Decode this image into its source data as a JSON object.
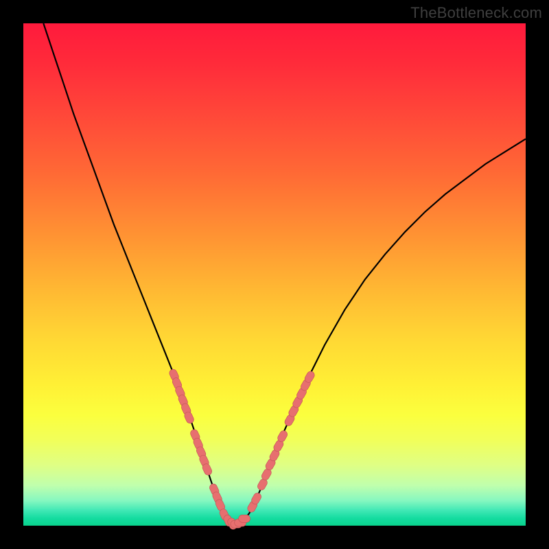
{
  "watermark": "TheBottleneck.com",
  "colors": {
    "frame": "#000000",
    "watermark": "#3f3f3f",
    "curve_stroke": "#000000",
    "marker_fill": "#e76f6f",
    "marker_stroke": "#c15555"
  },
  "chart_data": {
    "type": "line",
    "title": "",
    "xlabel": "",
    "ylabel": "",
    "xlim": [
      0,
      100
    ],
    "ylim": [
      0,
      100
    ],
    "grid": false,
    "legend": false,
    "series": [
      {
        "name": "curve",
        "x": [
          4,
          6,
          8,
          10,
          12,
          14,
          16,
          18,
          20,
          22,
          24,
          26,
          28,
          30,
          31,
          32,
          33,
          34,
          35,
          36,
          37,
          38,
          39,
          40,
          41,
          42,
          43,
          44,
          45,
          46,
          48,
          50,
          52,
          54,
          56,
          58,
          60,
          64,
          68,
          72,
          76,
          80,
          84,
          88,
          92,
          96,
          100
        ],
        "y": [
          100,
          94,
          88,
          82,
          76.5,
          71,
          65.5,
          60,
          55,
          50,
          45,
          40,
          35,
          30,
          27.5,
          25,
          22,
          19,
          16,
          13,
          10,
          7,
          4.5,
          2.5,
          1.2,
          0.5,
          0.5,
          1.2,
          2.5,
          4.5,
          9,
          14,
          19,
          23.5,
          28,
          32,
          36,
          43,
          49,
          54,
          58.5,
          62.5,
          66,
          69,
          72,
          74.5,
          77
        ]
      }
    ],
    "markers": [
      {
        "x": 30.0,
        "y": 30.0
      },
      {
        "x": 30.6,
        "y": 28.3
      },
      {
        "x": 31.2,
        "y": 26.6
      },
      {
        "x": 31.8,
        "y": 24.9
      },
      {
        "x": 32.4,
        "y": 23.2
      },
      {
        "x": 33.0,
        "y": 21.5
      },
      {
        "x": 34.2,
        "y": 18.0
      },
      {
        "x": 34.8,
        "y": 16.3
      },
      {
        "x": 35.4,
        "y": 14.6
      },
      {
        "x": 36.0,
        "y": 12.9
      },
      {
        "x": 36.6,
        "y": 11.2
      },
      {
        "x": 38.0,
        "y": 7.2
      },
      {
        "x": 38.6,
        "y": 5.6
      },
      {
        "x": 39.2,
        "y": 4.1
      },
      {
        "x": 40.0,
        "y": 2.2
      },
      {
        "x": 40.8,
        "y": 1.0
      },
      {
        "x": 41.6,
        "y": 0.4
      },
      {
        "x": 42.4,
        "y": 0.3
      },
      {
        "x": 43.2,
        "y": 0.6
      },
      {
        "x": 44.0,
        "y": 1.4
      },
      {
        "x": 45.6,
        "y": 3.8
      },
      {
        "x": 46.4,
        "y": 5.4
      },
      {
        "x": 47.6,
        "y": 8.2
      },
      {
        "x": 48.4,
        "y": 10.2
      },
      {
        "x": 49.2,
        "y": 12.2
      },
      {
        "x": 50.0,
        "y": 14.0
      },
      {
        "x": 50.8,
        "y": 15.9
      },
      {
        "x": 51.6,
        "y": 17.8
      },
      {
        "x": 53.0,
        "y": 21.0
      },
      {
        "x": 53.8,
        "y": 22.8
      },
      {
        "x": 54.6,
        "y": 24.6
      },
      {
        "x": 55.4,
        "y": 26.3
      },
      {
        "x": 56.2,
        "y": 28.0
      },
      {
        "x": 57.0,
        "y": 29.6
      }
    ]
  }
}
